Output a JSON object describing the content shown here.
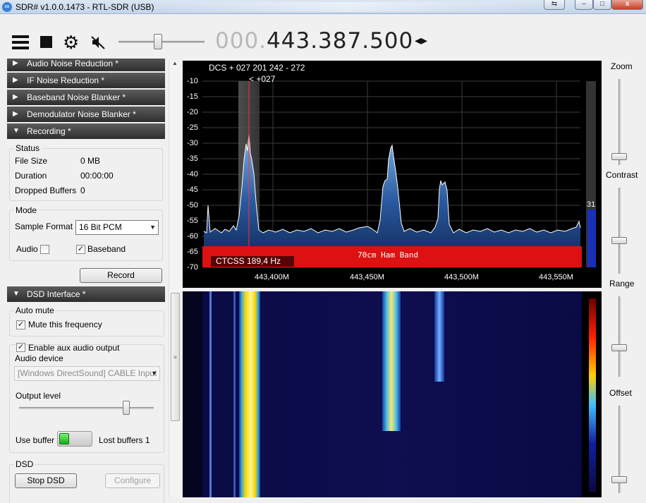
{
  "window": {
    "title": "SDR# v1.0.0.1473 - RTL-SDR (USB)",
    "back_glyph": "⇆",
    "min_glyph": "–",
    "max_glyph": "□",
    "close_glyph": "x"
  },
  "toolbar": {
    "frequency_dim": "000.",
    "frequency_main": "443.387.500",
    "tune_arrows": "◂▸",
    "volume_level": 0.45
  },
  "sections": {
    "audio_noise_reduction": "Audio Noise Reduction *",
    "if_noise_reduction": "IF Noise Reduction *",
    "baseband_noise_blanker": "Baseband Noise Blanker *",
    "demodulator_noise_blanker": "Demodulator Noise Blanker *",
    "recording": "Recording *",
    "dsd_interface": "DSD Interface *",
    "collapsed_arrow": "▶",
    "expanded_arrow": "▼"
  },
  "recording": {
    "status_title": "Status",
    "file_size_label": "File Size",
    "file_size_value": "0 MB",
    "duration_label": "Duration",
    "duration_value": "00:00:00",
    "dropped_label": "Dropped Buffers",
    "dropped_value": "0",
    "mode_title": "Mode",
    "sample_format_label": "Sample Format",
    "sample_format_value": "16 Bit PCM",
    "audio_label": "Audio",
    "audio_checked": false,
    "baseband_label": "Baseband",
    "baseband_checked": true,
    "record_button": "Record"
  },
  "dsd": {
    "auto_mute_title": "Auto mute",
    "mute_label": "Mute this frequency",
    "mute_checked": true,
    "aux_label": "Enable aux audio output",
    "aux_checked": true,
    "audio_device_label": "Audio device",
    "audio_device_value": "[Windows DirectSound] CABLE Input (V",
    "output_level_label": "Output level",
    "output_level": 0.78,
    "use_buffer_label": "Use buffer",
    "lost_buffers_label": "Lost buffers",
    "lost_buffers_value": "1",
    "dsd_title": "DSD",
    "stop_button": "Stop DSD",
    "configure_button": "Configure"
  },
  "spectrum": {
    "dcs_text": "DCS + 027 201 242  - 272",
    "marker_text": "< +027",
    "band_label": "70cm Ham Band",
    "ctcss_text": "CTCSS  189,4 Hz",
    "level_value": "31",
    "y_ticks": [
      "-10",
      "-15",
      "-20",
      "-25",
      "-30",
      "-35",
      "-40",
      "-45",
      "-50",
      "-55",
      "-60",
      "-65",
      "-70"
    ],
    "x_ticks": [
      "443,400M",
      "443,450M",
      "443,500M",
      "443,550M"
    ]
  },
  "right_panel": {
    "zoom_label": "Zoom",
    "contrast_label": "Contrast",
    "range_label": "Range",
    "offset_label": "Offset"
  },
  "colors": {
    "band_red": "#dd1111",
    "spectrum_fill": "#1a3d7a",
    "accent_blue": "#3a7fd5"
  },
  "icons": [
    "menu-icon",
    "stop-icon",
    "gear-icon",
    "mute-icon",
    "checkmark-icon",
    "chevron-down-icon"
  ]
}
